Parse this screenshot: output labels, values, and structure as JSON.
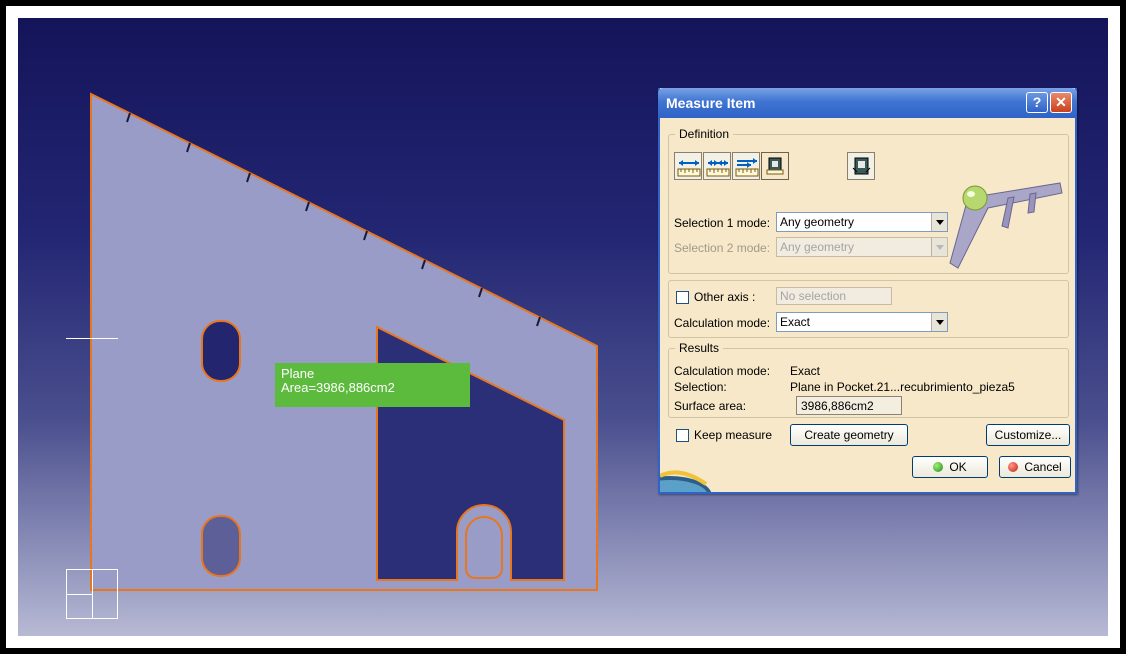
{
  "viewport": {
    "measure_label": {
      "line1": "Plane",
      "line2": "Area=3986,886cm2"
    },
    "colors": {
      "part_fill": "#9a9cc8",
      "part_edge": "#e8761f",
      "label_bg": "#5cbb3d"
    }
  },
  "dialog": {
    "title": "Measure Item",
    "help_label": "?",
    "close_label": "✕",
    "definition": {
      "legend": "Definition",
      "tools": [
        "measure-between-icon",
        "measure-between-chain-icon",
        "measure-between-fan-icon",
        "measure-item-icon",
        "measure-thickness-icon"
      ],
      "selection1_label": "Selection 1 mode:",
      "selection1_value": "Any geometry",
      "selection2_label": "Selection 2 mode:",
      "selection2_value": "Any geometry",
      "other_axis_label": "Other axis :",
      "other_axis_placeholder": "No selection",
      "calc_label": "Calculation mode:",
      "calc_value": "Exact"
    },
    "results": {
      "legend": "Results",
      "calc_label": "Calculation mode:",
      "calc_value": "Exact",
      "selection_label": "Selection:",
      "selection_value": "Plane in Pocket.21...recubrimiento_pieza5",
      "surface_label": "Surface area:",
      "surface_value": "3986,886cm2"
    },
    "keep_measure_label": "Keep measure",
    "create_geometry_label": "Create geometry",
    "customize_label": "Customize...",
    "ok_label": "OK",
    "cancel_label": "Cancel"
  }
}
